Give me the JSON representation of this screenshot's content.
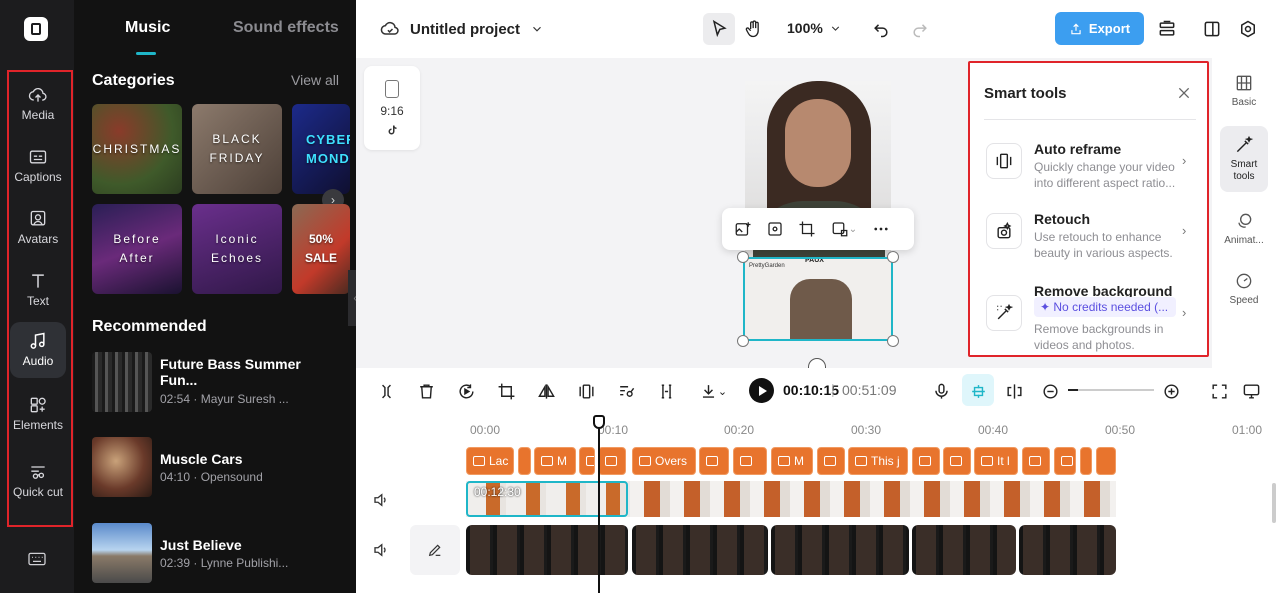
{
  "rail": {
    "items": [
      {
        "label": "Media",
        "icon": "cloud-upload-icon"
      },
      {
        "label": "Captions",
        "icon": "captions-icon"
      },
      {
        "label": "Avatars",
        "icon": "avatar-icon"
      },
      {
        "label": "Text",
        "icon": "text-icon"
      },
      {
        "label": "Audio",
        "icon": "music-note-icon"
      },
      {
        "label": "Elements",
        "icon": "elements-icon"
      },
      {
        "label": "Quick cut",
        "icon": "quick-cut-icon"
      }
    ],
    "active": "Audio"
  },
  "panel": {
    "tabs": [
      "Music",
      "Sound effects"
    ],
    "active_tab": "Music",
    "categories_title": "Categories",
    "view_all": "View all",
    "categories": [
      {
        "label": "CHRISTMAS",
        "color": "#5b7a3c"
      },
      {
        "label": "BLACK FRIDAY",
        "color": "#6a5a50"
      },
      {
        "label": "CYBER MONDAY",
        "color": "#1b1f4a"
      },
      {
        "label": "Before After",
        "color": "#3a2860"
      },
      {
        "label": "Iconic Echoes",
        "color": "#4a2d6a"
      },
      {
        "label": "50% SALE",
        "color": "#6a4a3a"
      }
    ],
    "recommended_title": "Recommended",
    "tracks": [
      {
        "name": "Future Bass Summer Fun...",
        "meta": "02:54 · Mayur Suresh ..."
      },
      {
        "name": "Muscle Cars",
        "meta": "04:10 · Opensound"
      },
      {
        "name": "Just Believe",
        "meta": "02:39 · Lynne Publishi..."
      }
    ]
  },
  "topbar": {
    "project_title": "Untitled project",
    "zoom": "100%",
    "export_label": "Export"
  },
  "canvas": {
    "ratio_label": "9:16",
    "video_caption": "PAUX",
    "video_brand": "PrettyGarden"
  },
  "smart_tools": {
    "title": "Smart tools",
    "tools": [
      {
        "name": "Auto reframe",
        "desc": "Quickly change your video into different aspect ratio..."
      },
      {
        "name": "Retouch",
        "desc": "Use retouch to enhance beauty in various aspects."
      },
      {
        "name": "Remove background",
        "badge": "✦ No credits needed (...",
        "desc": "Remove backgrounds in videos and photos."
      }
    ]
  },
  "right_rail": {
    "items": [
      {
        "label": "Basic",
        "icon": "basic-icon"
      },
      {
        "label": "Smart tools",
        "icon": "magic-wand-icon"
      },
      {
        "label": "Animat...",
        "icon": "animation-icon"
      },
      {
        "label": "Speed",
        "icon": "speed-icon"
      }
    ],
    "active": "Smart tools"
  },
  "timeline": {
    "current_time": "00:10:15",
    "total_time": "00:51:09",
    "ruler": [
      "00:00",
      "00:10",
      "00:20",
      "00:30",
      "00:40",
      "00:50",
      "01:00"
    ],
    "captions": [
      "Lac",
      "",
      "M",
      "",
      "",
      "Overs",
      "",
      "",
      "M",
      "",
      "This j",
      "",
      "",
      "It l",
      "",
      "",
      "",
      ""
    ],
    "clip_time": "00:12:30"
  }
}
